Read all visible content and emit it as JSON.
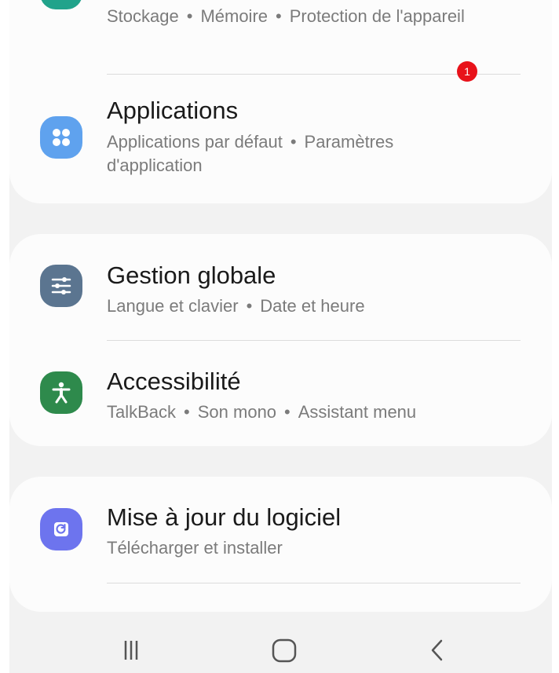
{
  "items": [
    {
      "key": "device-care",
      "subtitle_parts": [
        "Stockage",
        "Mémoire",
        "Protection de l'appareil"
      ],
      "icon": "device-care-icon",
      "icon_color": "#21a38b"
    },
    {
      "key": "applications",
      "title": "Applications",
      "subtitle_parts": [
        "Applications par défaut",
        "Paramètres d'application"
      ],
      "icon": "apps-grid-icon",
      "icon_color": "#5fa2ee",
      "badge": "1"
    },
    {
      "key": "general-management",
      "title": "Gestion globale",
      "subtitle_parts": [
        "Langue et clavier",
        "Date et heure"
      ],
      "icon": "sliders-icon",
      "icon_color": "#5b7590"
    },
    {
      "key": "accessibility",
      "title": "Accessibilité",
      "subtitle_parts": [
        "TalkBack",
        "Son mono",
        "Assistant menu"
      ],
      "icon": "accessibility-person-icon",
      "icon_color": "#2e8a4c"
    },
    {
      "key": "software-update",
      "title": "Mise à jour du logiciel",
      "subtitle_parts": [
        "Télécharger et installer"
      ],
      "icon": "software-update-icon",
      "icon_color": "#6d74ee"
    }
  ],
  "navbar": {
    "recents_icon": "recents-icon",
    "home_icon": "home-icon",
    "back_icon": "back-icon"
  },
  "colors": {
    "background": "#f2f2f2",
    "card": "#fcfcfc",
    "badge": "#e8121a"
  }
}
